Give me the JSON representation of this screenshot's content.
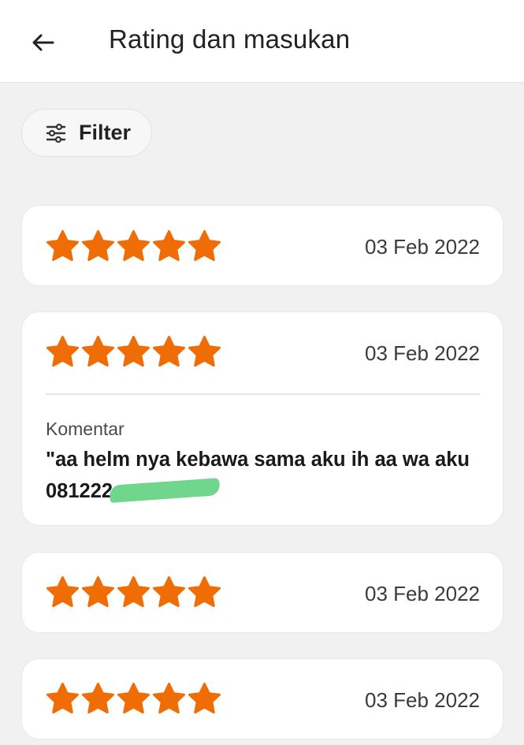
{
  "header": {
    "back_icon": "arrow-left-icon",
    "title": "Rating dan masukan"
  },
  "filter": {
    "icon": "sliders-icon",
    "label": "Filter"
  },
  "colors": {
    "star": "#f06d06",
    "background": "#f1f1f1",
    "card": "#ffffff",
    "redaction": "#6fd68b"
  },
  "reviews": [
    {
      "rating": 5,
      "date": "03 Feb 2022"
    },
    {
      "rating": 5,
      "date": "03 Feb 2022",
      "comment_label": "Komentar",
      "comment_text": "\"aa helm nya kebawa sama aku ih aa wa aku 081222"
    },
    {
      "rating": 5,
      "date": "03 Feb 2022"
    },
    {
      "rating": 5,
      "date": "03 Feb 2022"
    }
  ]
}
